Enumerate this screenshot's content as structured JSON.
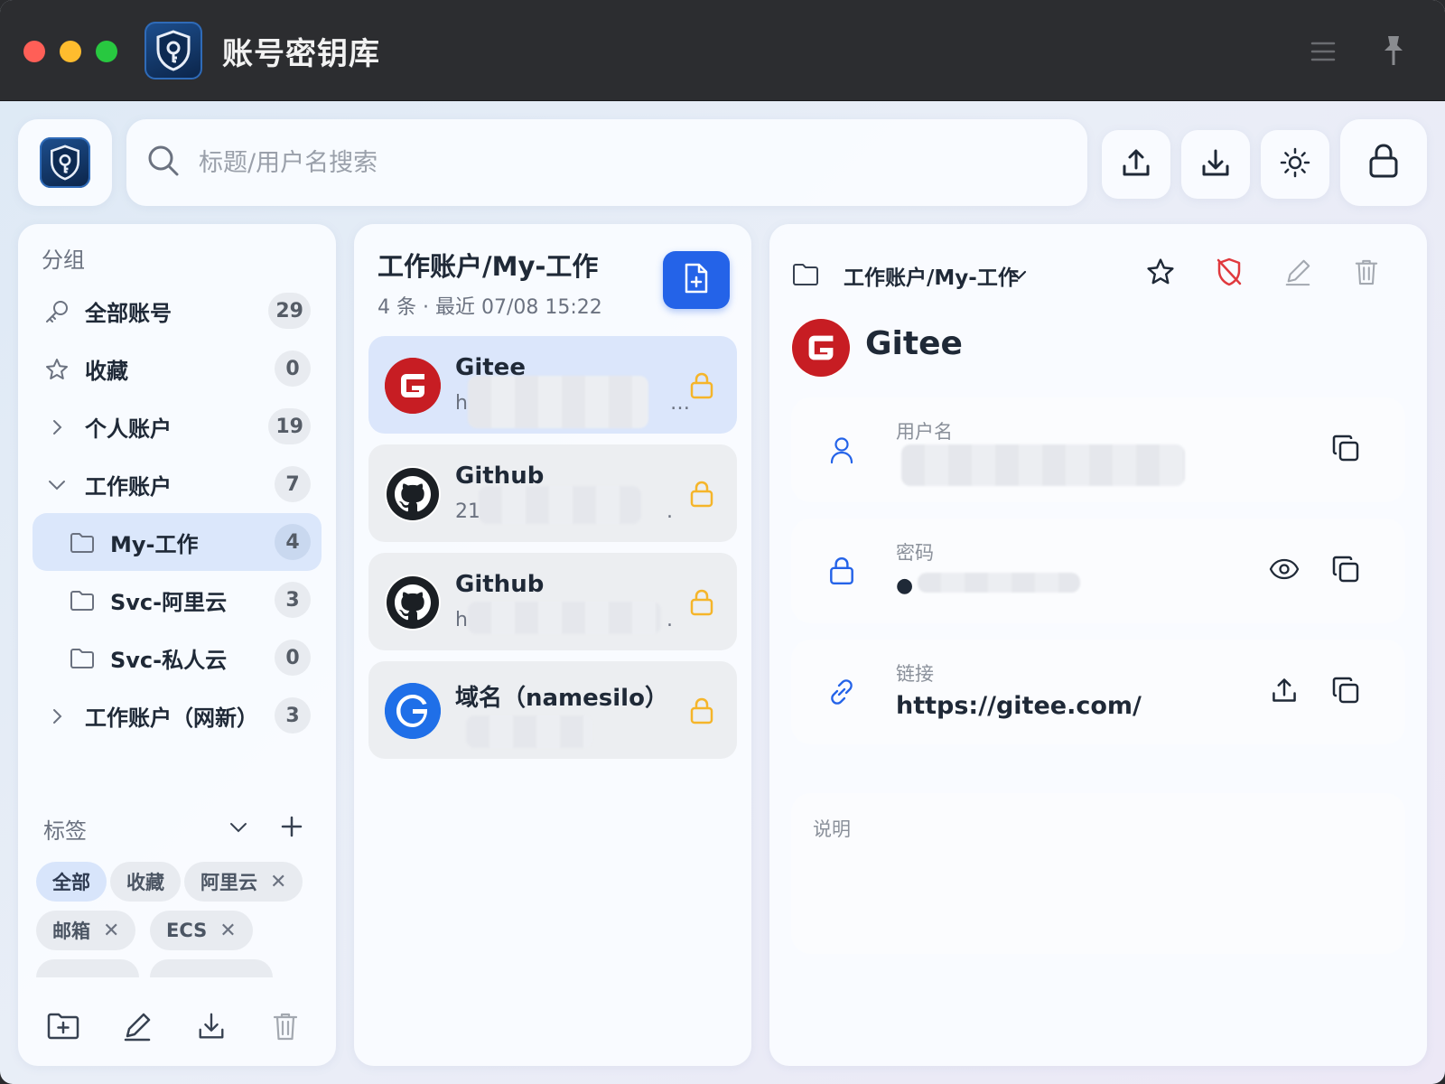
{
  "app": {
    "title": "账号密钥库"
  },
  "search": {
    "placeholder": "标题/用户名搜索"
  },
  "toolbar": {
    "upload_icon": "upload-icon",
    "download_icon": "download-icon",
    "theme_icon": "sun-icon",
    "lock_icon": "lock-icon"
  },
  "sidebar": {
    "heading": "分组",
    "groups": [
      {
        "label": "全部账号",
        "count": "29",
        "icon": "key-icon"
      },
      {
        "label": "收藏",
        "count": "0",
        "icon": "star-icon"
      },
      {
        "label": "个人账户",
        "count": "19",
        "icon": "chevron-right-icon"
      },
      {
        "label": "工作账户",
        "count": "7",
        "icon": "chevron-down-icon"
      },
      {
        "label": "My-工作",
        "count": "4",
        "icon": "folder-icon",
        "active": true
      },
      {
        "label": "Svc-阿里云",
        "count": "3",
        "icon": "folder-icon"
      },
      {
        "label": "Svc-私人云",
        "count": "0",
        "icon": "folder-icon"
      },
      {
        "label": "工作账户（网新）",
        "count": "3",
        "icon": "chevron-right-icon"
      }
    ],
    "tags_heading": "标签",
    "tags": [
      {
        "label": "全部"
      },
      {
        "label": "收藏"
      },
      {
        "label": "阿里云"
      },
      {
        "label": "邮箱"
      },
      {
        "label": "ECS"
      }
    ],
    "tag_remove": "✕"
  },
  "list": {
    "title": "工作账户/My-工作",
    "subtitle": "4 条 · 最近 07/08 15:22",
    "entries": [
      {
        "title": "Gitee",
        "sub_prefix": "h",
        "sub_suffix": "…",
        "icon": "gitee-logo"
      },
      {
        "title": "Github",
        "sub_prefix": "21",
        "sub_suffix": ".",
        "icon": "github-logo"
      },
      {
        "title": "Github",
        "sub_prefix": "h",
        "sub_suffix": ".",
        "icon": "github-logo"
      },
      {
        "title": "域名（namesilo）",
        "sub_prefix": "",
        "sub_suffix": "",
        "icon": "namesilo-logo"
      }
    ]
  },
  "detail": {
    "path": "工作账户/My-工作",
    "name": "Gitee",
    "fields": {
      "username_label": "用户名",
      "password_label": "密码",
      "password_mask": "●",
      "link_label": "链接",
      "link_value": "https://gitee.com/"
    },
    "notes_label": "说明"
  },
  "colors": {
    "accent": "#2463e8",
    "lock": "#f5b52a",
    "danger": "#e0393e",
    "gitee": "#c71d23"
  }
}
